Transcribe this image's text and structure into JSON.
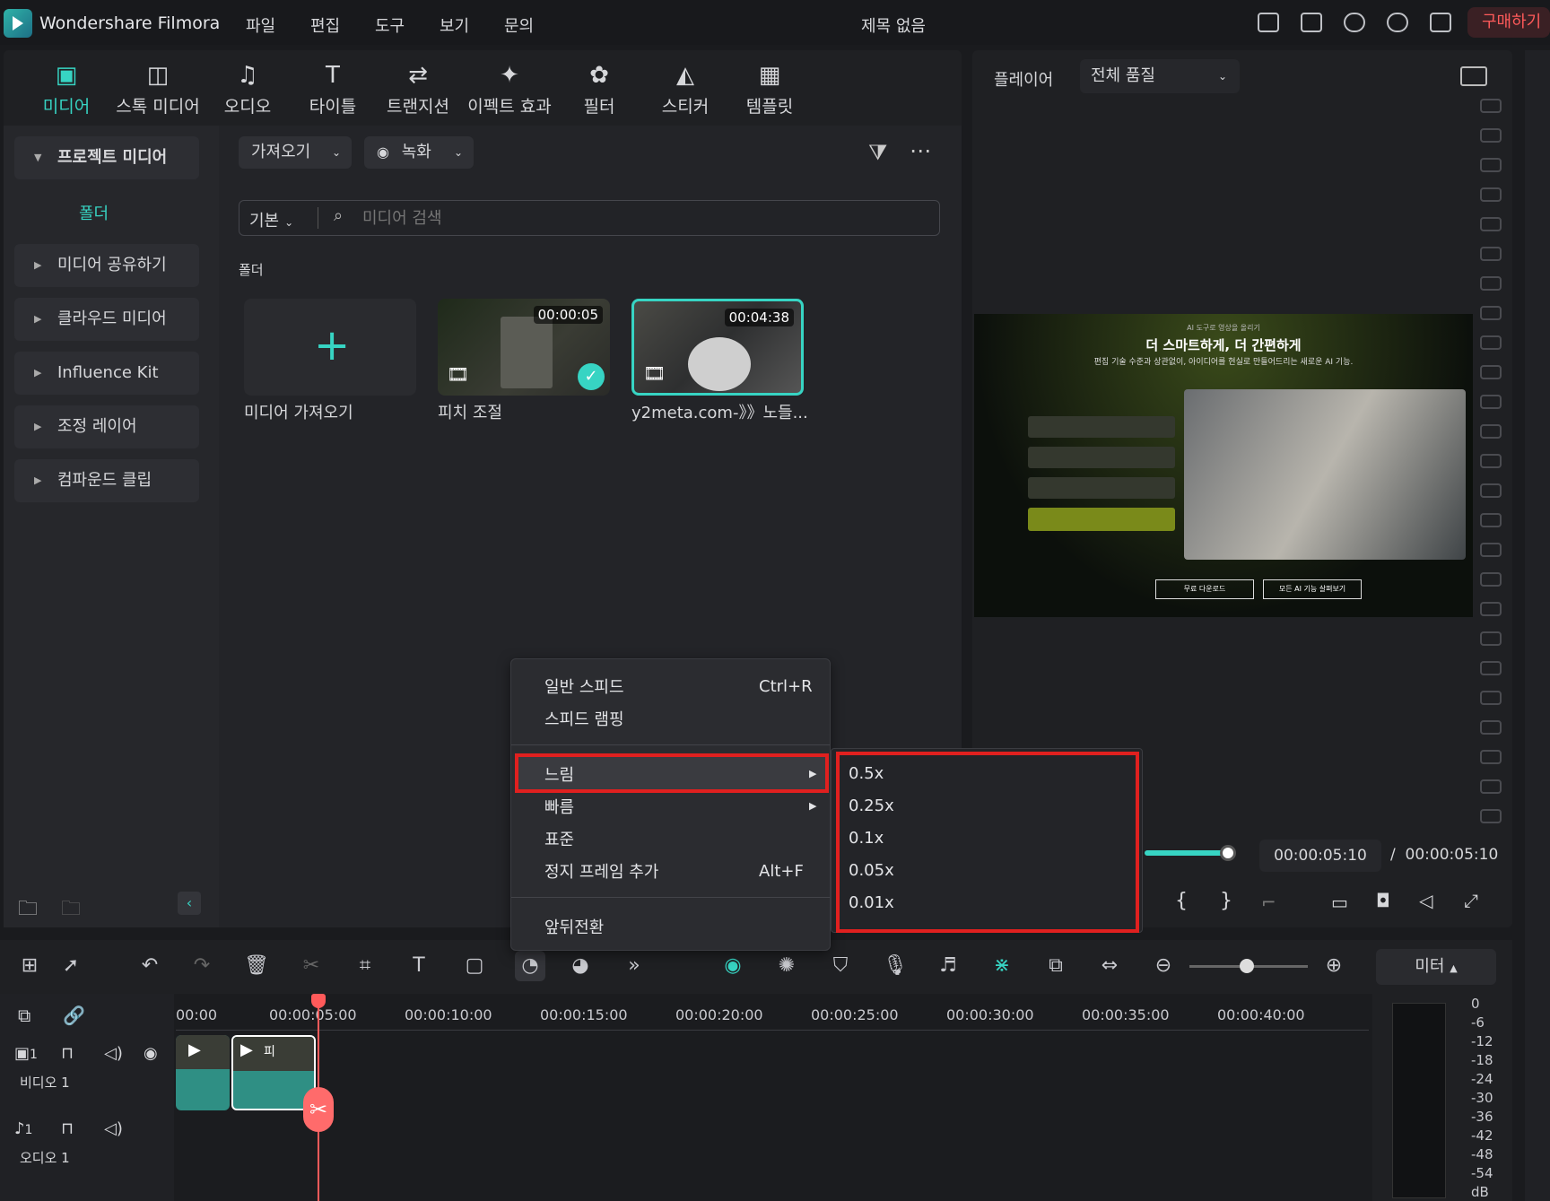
{
  "titlebar": {
    "app_name": "Wondershare Filmora",
    "menus": [
      "파일",
      "편집",
      "도구",
      "보기",
      "문의"
    ],
    "doc_title": "제목 없음",
    "buy_label": "구매하기"
  },
  "media_tabs": [
    {
      "label": "미디어",
      "icon": "media-icon",
      "active": true
    },
    {
      "label": "스톡 미디어",
      "icon": "stock-media-icon"
    },
    {
      "label": "오디오",
      "icon": "music-note-icon"
    },
    {
      "label": "타이틀",
      "icon": "title-t-icon"
    },
    {
      "label": "트랜지션",
      "icon": "transition-icon"
    },
    {
      "label": "이펙트 효과",
      "icon": "effects-star-icon"
    },
    {
      "label": "필터",
      "icon": "filter-icon"
    },
    {
      "label": "스티커",
      "icon": "sticker-icon"
    },
    {
      "label": "템플릿",
      "icon": "template-icon"
    }
  ],
  "sidebar": {
    "items": [
      {
        "label": "프로젝트 미디어",
        "expanded": true
      },
      {
        "label": "미디어 공유하기"
      },
      {
        "label": "클라우드 미디어"
      },
      {
        "label": "Influence Kit"
      },
      {
        "label": "조정 레이어"
      },
      {
        "label": "컴파운드 클립"
      }
    ],
    "folder_label": "폴더"
  },
  "toolbar": {
    "import_label": "가져오기",
    "record_label": "녹화",
    "sort_label": "기본",
    "search_placeholder": "미디어 검색"
  },
  "media": {
    "folder_heading": "폴더",
    "import_card_label": "미디어 가져오기",
    "items": [
      {
        "label": "피치 조절",
        "duration": "00:00:05",
        "checked": true
      },
      {
        "label": "y2meta.com-》》노들...",
        "duration": "00:04:38",
        "selected": true
      }
    ]
  },
  "player": {
    "label": "플레이어",
    "quality": "전체 품질",
    "preview": {
      "small_top": "AI 도구로 영상을 올리기",
      "headline": "더 스마트하게, 더 간편하게",
      "subline": "편집 기술 수준과 상관없이, 아이디어를 현실로 만들어드리는 새로운 AI 기능.",
      "btn_download": "무료 다운로드",
      "btn_all": "모든 AI 기능 살펴보기"
    },
    "current_time": "00:00:05:10",
    "separator": "/",
    "total_time": "00:00:05:10",
    "progress": 1.0
  },
  "context_menu": {
    "items": [
      {
        "label": "일반 스피드",
        "shortcut": "Ctrl+R"
      },
      {
        "label": "스피드 램핑",
        "shortcut": ""
      },
      {
        "label": "느림",
        "submenu": true,
        "highlighted": true
      },
      {
        "label": "빠름",
        "submenu": true
      },
      {
        "label": "표준",
        "shortcut": ""
      },
      {
        "label": "정지 프레임 추가",
        "shortcut": "Alt+F"
      },
      {
        "label": "앞뒤전환",
        "shortcut": ""
      }
    ],
    "slow_submenu": [
      "0.5x",
      "0.25x",
      "0.1x",
      "0.05x",
      "0.01x"
    ]
  },
  "timeline": {
    "ruler": [
      "00:00",
      "00:00:05:00",
      "00:00:10:00",
      "00:00:15:00",
      "00:00:20:00",
      "00:00:25:00",
      "00:00:30:00",
      "00:00:35:00",
      "00:00:40:00"
    ],
    "tracks": [
      {
        "label": "비디오 1",
        "number": "1"
      },
      {
        "label": "오디오 1",
        "number": "1"
      }
    ],
    "clip_text": "피"
  },
  "meter": {
    "label": "미터",
    "scale": [
      "0",
      "-6",
      "-12",
      "-18",
      "-24",
      "-30",
      "-36",
      "-42",
      "-48",
      "-54",
      "dB"
    ]
  },
  "colors": {
    "accent": "#37d4c3",
    "highlight_box": "#e0201f",
    "playhead": "#ff5a5a"
  }
}
